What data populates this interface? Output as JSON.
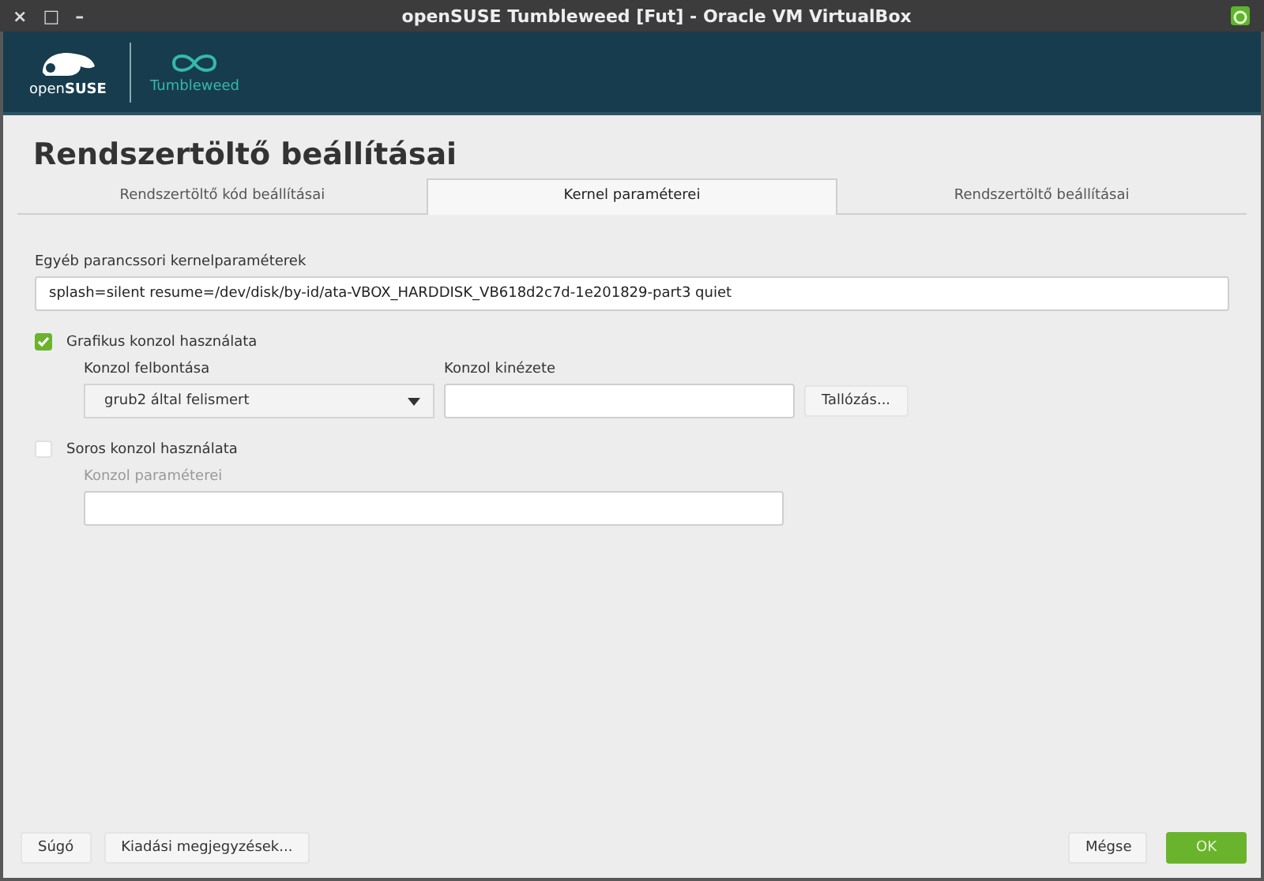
{
  "window": {
    "title": "openSUSE Tumbleweed [Fut] - Oracle VM VirtualBox",
    "controls": [
      "×",
      "□",
      "–"
    ]
  },
  "header": {
    "brand": "open**SUSE**",
    "product": "Tumbleweed"
  },
  "page_title": "Rendszertöltő beállításai",
  "tabs": [
    {
      "label": "Rendszertöltő kód beállításai",
      "selected": false
    },
    {
      "label": "Kernel paraméterei",
      "selected": true
    },
    {
      "label": "Rendszertöltő beállításai",
      "selected": false
    }
  ],
  "kernel_params": {
    "label": "Egyéb parancssori kernelparaméterek",
    "value": "splash=silent resume=/dev/disk/by-id/ata-VBOX_HARDDISK_VB618d2c7d-1e201829-part3 quiet"
  },
  "graphical_console": {
    "label": "Grafikus konzol használata",
    "checked": true,
    "resolution_label": "Konzol felbontása",
    "resolution_value": "grub2 által felismert",
    "theme_label": "Konzol kinézete",
    "browse_button": "Tallózás..."
  },
  "serial_console": {
    "label": "Soros konzol használata",
    "checked": false,
    "params_label": "Konzol paraméterei",
    "disabled": true
  },
  "footer": {
    "left_buttons": [
      "Súgó",
      "Kiadási megjegyzések..."
    ],
    "cancel": "Mégse",
    "ok": "OK"
  }
}
